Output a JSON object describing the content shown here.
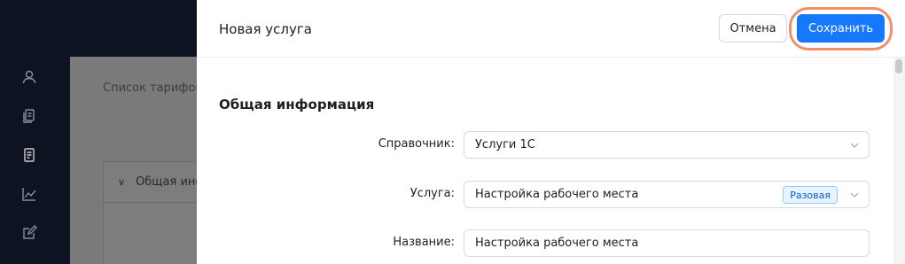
{
  "background": {
    "breadcrumb": "Список тарифов",
    "card_header": "Общая информация"
  },
  "drawer": {
    "title": "Новая услуга",
    "cancel_label": "Отмена",
    "save_label": "Сохранить",
    "section_title": "Общая информация",
    "fields": {
      "directory": {
        "label": "Справочник:",
        "value": "Услуги 1С"
      },
      "service": {
        "label": "Услуга:",
        "value": "Настройка рабочего места",
        "tag": "Разовая"
      },
      "name": {
        "label": "Название:",
        "value": "Настройка рабочего места"
      }
    }
  },
  "sidebar": {
    "icons": [
      "user-icon",
      "documents-icon",
      "invoice-icon",
      "chart-icon",
      "edit-icon"
    ]
  },
  "colors": {
    "primary": "#1677ff",
    "highlight": "#f0906a",
    "sidebar_bg": "#0d1321"
  }
}
